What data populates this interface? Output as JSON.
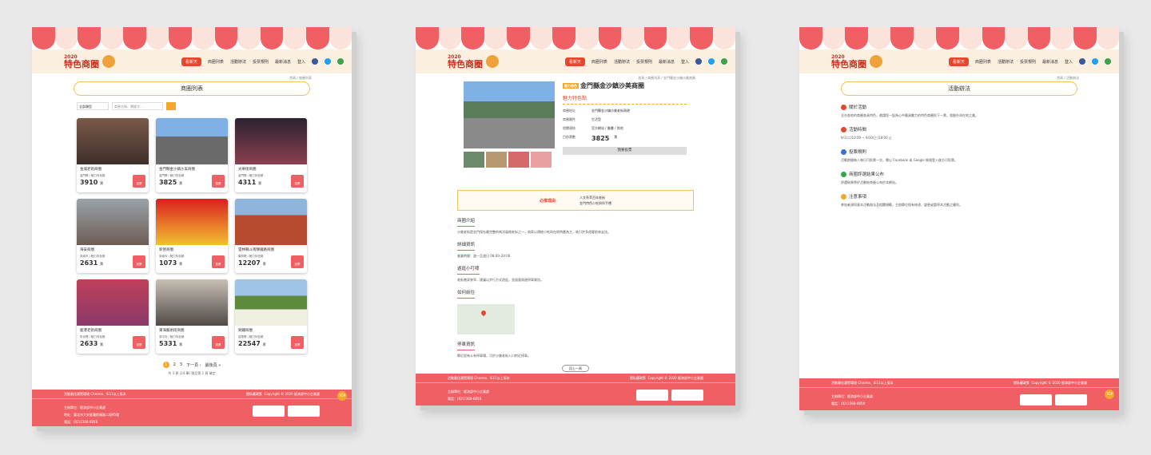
{
  "brand": {
    "year": "2020",
    "name": "特色商圈"
  },
  "nav": {
    "button": "看新天",
    "items": [
      "商圈列表",
      "活動辦法",
      "投票規則",
      "最新消息",
      "登入"
    ]
  },
  "panel1": {
    "breadcrumb": "首頁 / 商圈列表",
    "title": "商圈列表",
    "filter_select": "全部類型",
    "search_placeholder": "商圈名稱、關鍵字...",
    "cards": [
      {
        "name": "金城老街商圈",
        "region": "金門縣 / 魅力特色獎",
        "votes": "3910",
        "unit": "票",
        "vote_label": "投票"
      },
      {
        "name": "金門縣金沙鎮沙美商圈",
        "region": "金門縣 / 魅力特色獎",
        "votes": "3825",
        "unit": "票",
        "vote_label": "投票"
      },
      {
        "name": "光華街商圈",
        "region": "金門縣 / 魅力特色獎",
        "votes": "4311",
        "unit": "票",
        "vote_label": "投票"
      },
      {
        "name": "海安商圈",
        "region": "臺南市 / 魅力特色獎",
        "votes": "2631",
        "unit": "票",
        "vote_label": "投票"
      },
      {
        "name": "新營商圈",
        "region": "臺南市 / 魅力特色獎",
        "votes": "1073",
        "unit": "票",
        "vote_label": "投票"
      },
      {
        "name": "雲林縣斗南驛鐵路商圈",
        "region": "雲林縣 / 魅力特色獎",
        "votes": "12207",
        "unit": "票",
        "vote_label": "投票"
      },
      {
        "name": "鹿港老街商圈",
        "region": "彰化縣 / 魅力特色獎",
        "votes": "2633",
        "unit": "票",
        "vote_label": "投票"
      },
      {
        "name": "東海藝術街商圈",
        "region": "臺中市 / 魅力特色獎",
        "votes": "5331",
        "unit": "票",
        "vote_label": "投票"
      },
      {
        "name": "銅鑼商圈",
        "region": "苗栗縣 / 魅力特色獎",
        "votes": "22547",
        "unit": "票",
        "vote_label": "投票"
      }
    ],
    "pager": {
      "pages": [
        "1",
        "2",
        "3"
      ],
      "next": "下一頁 ›",
      "last": "最後頁 »"
    },
    "pager_info": "共 3 頁 (24 筆) 跳至第 1 頁 確定"
  },
  "panel2": {
    "breadcrumb": "首頁 / 商圈列表 / 金門縣金沙鎮沙美商圈",
    "tag": "魅力特色",
    "title": "金門縣金沙鎮沙美商圈",
    "charm": "魅力特色點",
    "rows": [
      {
        "k": "商圈地址",
        "v": "金門縣金沙鎮沙美老街周邊"
      },
      {
        "k": "商圈屬性",
        "v": "生活型"
      },
      {
        "k": "相關連結",
        "v": "官方網站 / 臉書 / 其他"
      }
    ],
    "votes_label": "目前票數",
    "votes": "3825",
    "votes_unit": "票",
    "vote_btn": "我要投票",
    "must_label": "必推理由",
    "must_items": [
      "人文薈萃百年老街",
      "金門特色小吃與伴手禮"
    ],
    "sections": [
      {
        "h": "商圈介紹",
        "p": "沙美老街是金門保存最完整的南洋風格老街之一，商家以傳統小吃與在地特產為主，吸引許多遊客前來走訪。"
      },
      {
        "h": "詳細資訊",
        "p": "營業時間：週一至週日 08:00–20:00"
      },
      {
        "h": "遊逛小叮嚀",
        "p": "老街巷弄狹窄，建議以步行方式遊逛，並留意周邊停車資訊。"
      },
      {
        "h": "如何前往",
        "p": ""
      },
      {
        "h": "停車資訊",
        "p": "鄰近設有公有停車場，可於沙美老街入口附近停車。"
      }
    ],
    "back": "回上一頁"
  },
  "panel3": {
    "breadcrumb": "首頁 / 活動辦法",
    "title": "活動辦法",
    "sections": [
      {
        "h": "關於活動",
        "p": "全台各地的商圈各具特色，邀請您一起為心中最具魅力的特色商圈投下一票，發掘台灣在地之美。",
        "color": "#e6462d"
      },
      {
        "h": "活動時間",
        "p": "9/1(二)10:00 ~ 9/30(三)18:00 止",
        "color": "#e6462d"
      },
      {
        "h": "投票規則",
        "p": "活動期間每人每日可投票一次，需以 Facebook 或 Google 帳號登入後方可投票。",
        "color": "#3b6fd8"
      },
      {
        "h": "商圈評選結果公布",
        "p": "評選結果將於活動結束後公布於本網站。",
        "color": "#3aa34b"
      },
      {
        "h": "注意事項",
        "p": "參加者須同意本活動辦法及相關規範，主辦單位保有修改、變更或暫停本活動之權利。",
        "color": "#f3a72c"
      }
    ]
  },
  "footer": {
    "top": "活動最佳瀏覽環境 Chrome、IE11以上版本",
    "links": "隱私權政策",
    "copyright": "Copyright © 2020 經濟部中小企業處",
    "org": "主辦單位：經濟部中小企業處",
    "address": "地址：臺北市大安區羅斯福路二段95號",
    "phone": "電話：(02)2368-6858",
    "top_btn": "TOP"
  }
}
